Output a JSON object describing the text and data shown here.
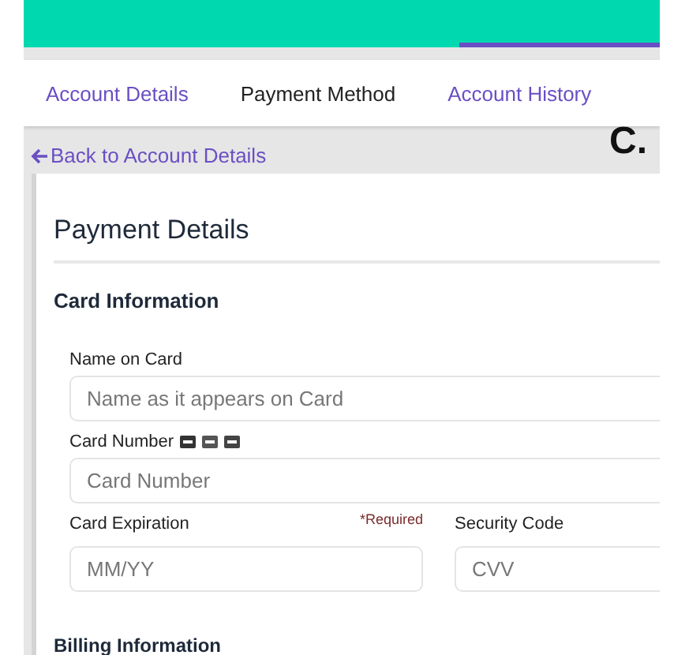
{
  "subnav": {
    "tabs": [
      {
        "label": "Account Details",
        "selected": false
      },
      {
        "label": "Payment Method",
        "selected": true
      },
      {
        "label": "Account History",
        "selected": false
      }
    ]
  },
  "annotation": "C.",
  "back_link": "Back to Account Details",
  "card": {
    "title": "Payment Details",
    "section": "Card Information",
    "name_field": {
      "label": "Name on Card",
      "placeholder": "Name as it appears on Card"
    },
    "number_field": {
      "label": "Card Number",
      "placeholder": "Card Number"
    },
    "expiration_field": {
      "label": "Card Expiration",
      "required": "*Required",
      "placeholder": "MM/YY"
    },
    "security_field": {
      "label": "Security Code",
      "placeholder": "CVV"
    },
    "next_section": "Billing Information"
  }
}
